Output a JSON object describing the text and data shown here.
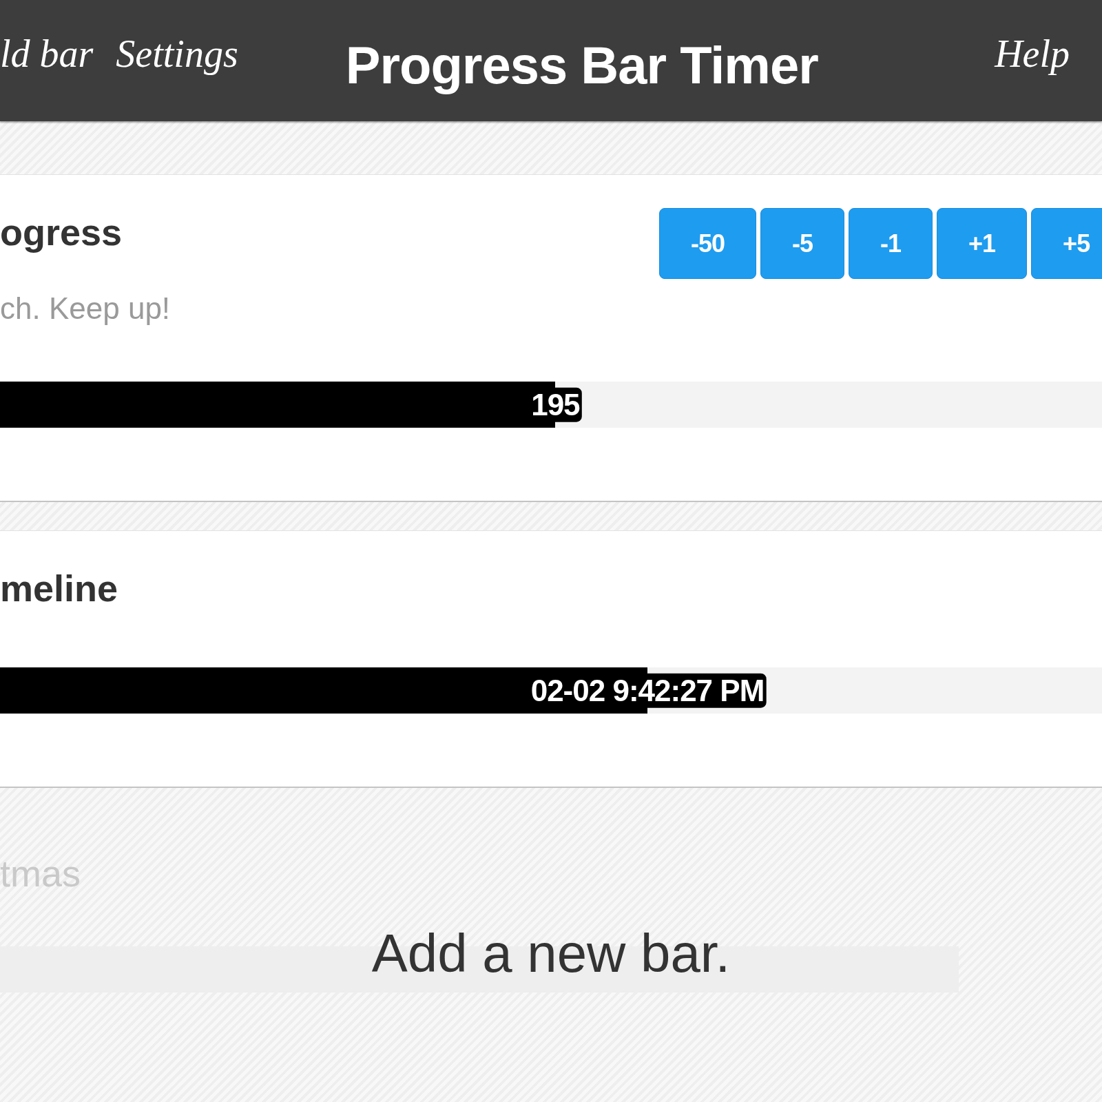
{
  "header": {
    "nav_left": [
      "ld bar",
      "Settings"
    ],
    "title": "Progress Bar Timer",
    "nav_right": [
      "Help"
    ]
  },
  "bars": [
    {
      "title": "ogress",
      "subtitle": "ch. Keep up!",
      "buttons": [
        "-50",
        "-5",
        "-1",
        "+1",
        "+5"
      ],
      "level": 0.504,
      "reading": "195"
    },
    {
      "title": "meline",
      "level": 0.5875,
      "reading": "02-02 9:42:27 PM"
    }
  ],
  "ghost": {
    "title": "tmas",
    "prompt": "Add a new bar."
  }
}
